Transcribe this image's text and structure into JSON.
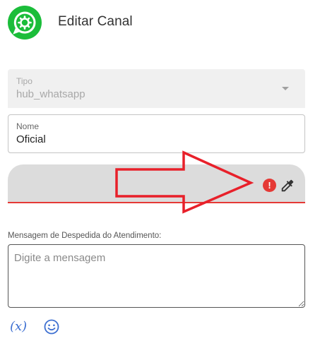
{
  "header": {
    "title": "Editar Canal",
    "logo_icon": "whatsapp-gear-logo",
    "logo_color": "#1bbd3a"
  },
  "form": {
    "tipo": {
      "label": "Tipo",
      "value": "hub_whatsapp"
    },
    "nome": {
      "label": "Nome",
      "value": "Oficial"
    },
    "color": {
      "status": "error",
      "error_icon": "error-icon",
      "action_icon": "eyedropper-icon",
      "error_color": "#e53935"
    },
    "mensagem": {
      "label": "Mensagem de Despedida do Atendimento:",
      "placeholder": "Digite a mensagem",
      "value": ""
    }
  },
  "toolbar": {
    "variable_label": "(x)",
    "emoji_icon": "smiley-icon",
    "accent": "#3d6fd1"
  }
}
